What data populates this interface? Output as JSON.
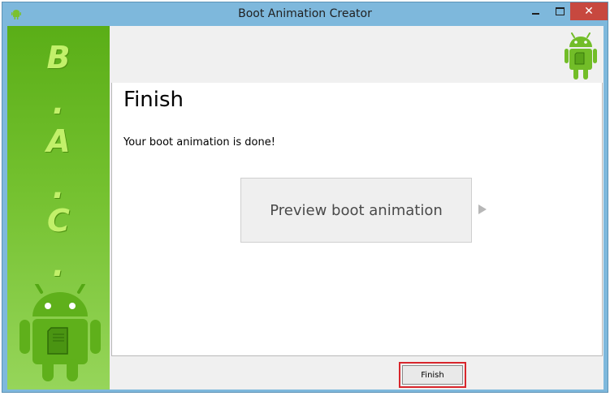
{
  "window": {
    "title": "Boot Animation Creator",
    "close_glyph": "✕"
  },
  "sidebar": {
    "letters": [
      "B",
      ".",
      "A",
      ".",
      "C",
      "."
    ]
  },
  "main": {
    "heading": "Finish",
    "message": "Your boot animation is done!",
    "preview_button_label": "Preview boot animation"
  },
  "footer": {
    "finish_label": "Finish"
  },
  "colors": {
    "accent_green": "#7bc12f",
    "titlebar": "#7eb8dc",
    "close_red": "#c7483f",
    "highlight_red": "#d8262c"
  },
  "icons": [
    "android-robot-icon",
    "minimize-icon",
    "maximize-icon",
    "close-icon",
    "play-arrow-icon"
  ]
}
